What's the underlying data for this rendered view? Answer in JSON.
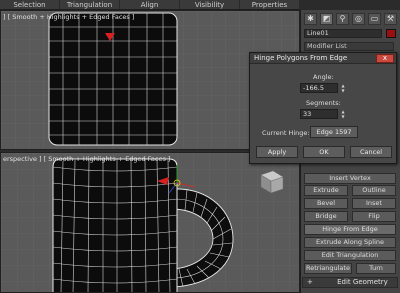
{
  "menu": {
    "tabs": [
      "Selection",
      "Triangulation",
      "Align",
      "Visibility",
      "Properties"
    ]
  },
  "viewport_top": {
    "label": "] [ Smooth + Highlights + Edged Faces ]"
  },
  "viewport_bottom": {
    "label": "erspective ] [ Smooth + Highlights + Edged Faces ]"
  },
  "command_panel": {
    "object_name": "Line01",
    "modifier_list": "Modifier List",
    "color_swatch": "#9a0f0f",
    "tool_icons": [
      "create-icon",
      "modify-icon",
      "hierarchy-icon",
      "motion-icon",
      "display-icon",
      "utilities-icon"
    ],
    "buttons": {
      "insert_vertex": "Insert Vertex",
      "extrude": "Extrude",
      "outline": "Outline",
      "bevel": "Bevel",
      "inset": "Inset",
      "bridge": "Bridge",
      "flip": "Flip",
      "hinge_from_edge": "Hinge From Edge",
      "extrude_along_spline": "Extrude Along Spline",
      "edit_triangulation": "Edit Triangulation",
      "retriangulate": "Retriangulate",
      "turn": "Turn"
    },
    "rollout_edit_geometry": "Edit Geometry",
    "rollout_sign": "+"
  },
  "dialog": {
    "title": "Hinge Polygons From Edge",
    "close_label": "x",
    "angle_label": "Angle:",
    "angle_value": "-166.5",
    "segments_label": "Segments:",
    "segments_value": "33",
    "current_hinge_label": "Current Hinge:",
    "current_hinge_value": "Edge 1597",
    "apply_label": "Apply",
    "ok_label": "OK",
    "cancel_label": "Cancel"
  }
}
